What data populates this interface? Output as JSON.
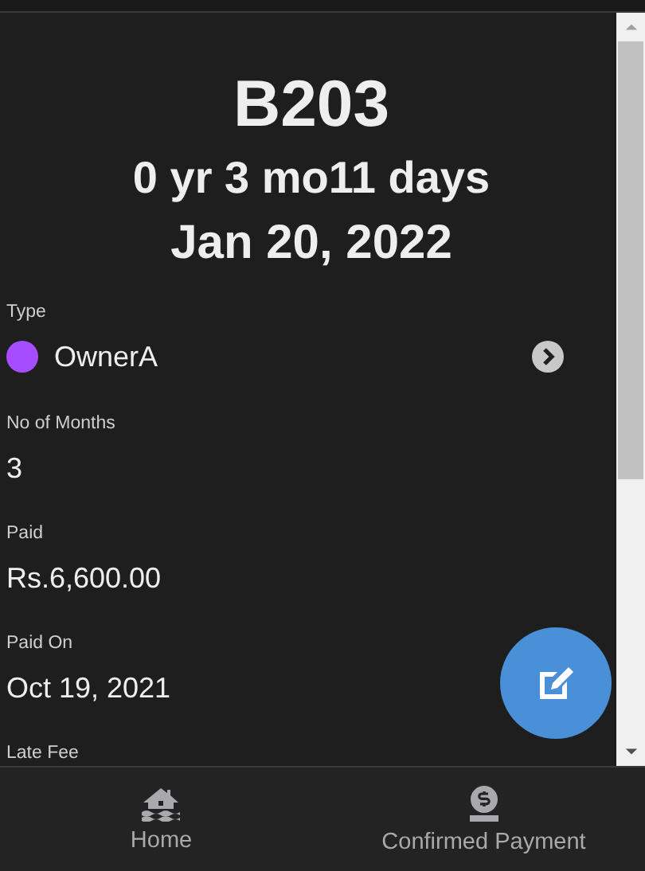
{
  "header": {
    "title": "B203",
    "duration": "0 yr 3 mo11 days",
    "date": "Jan 20, 2022"
  },
  "fields": [
    {
      "kind": "select",
      "label": "Type",
      "value": "OwnerA",
      "color": "#a64dff"
    },
    {
      "kind": "text",
      "label": "No of Months",
      "value": "3"
    },
    {
      "kind": "text",
      "label": "Paid",
      "value": "Rs.6,600.00"
    },
    {
      "kind": "text",
      "label": "Paid On",
      "value": "Oct 19, 2021"
    },
    {
      "kind": "text",
      "label": "Late Fee"
    }
  ],
  "nav": [
    {
      "label": "Home",
      "kind": "home"
    },
    {
      "label": "Confirmed Payment",
      "kind": "payment"
    }
  ]
}
